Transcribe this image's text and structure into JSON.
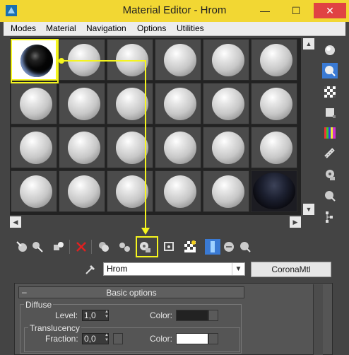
{
  "window": {
    "title": "Material Editor - Hrom",
    "minimize_icon": "minimize-icon",
    "maximize_icon": "maximize-icon",
    "close_icon": "close-icon"
  },
  "menu": {
    "items": [
      "Modes",
      "Material",
      "Navigation",
      "Options",
      "Utilities"
    ]
  },
  "slots": {
    "active_index": 0,
    "env_index": 23,
    "count": 24
  },
  "material": {
    "name": "Hrom",
    "type": "CoronaMtl"
  },
  "basic_options": {
    "rollout_title": "Basic options",
    "diffuse": {
      "group_label": "Diffuse",
      "level_label": "Level:",
      "level_value": "1,0",
      "color_label": "Color:",
      "color": "#222222"
    },
    "translucency": {
      "group_label": "Translucency",
      "fraction_label": "Fraction:",
      "fraction_value": "0,0",
      "color_label": "Color:",
      "color": "#ffffff"
    }
  },
  "colors": {
    "titlebar": "#f2d733",
    "highlight": "#f5f51e",
    "selected_tool": "#3a7ad4"
  }
}
